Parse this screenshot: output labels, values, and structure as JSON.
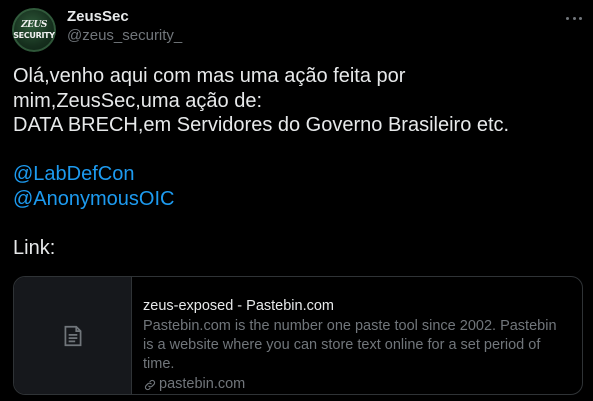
{
  "author": {
    "display_name": "ZeusSec",
    "handle": "@zeus_security_",
    "avatar_logo": [
      "ZEUS",
      "SECURITY"
    ]
  },
  "tweet": {
    "lines": [
      "Olá,venho aqui com mas uma ação feita por",
      "mim,ZeusSec,uma ação de:",
      "DATA BRECH,em Servidores do Governo Brasileiro etc."
    ],
    "mentions": [
      "@LabDefCon",
      "@AnonymousOIC"
    ],
    "link_label": "Link:"
  },
  "card": {
    "title": "zeus-exposed - Pastebin.com",
    "description": "Pastebin.com is the number one paste tool since 2002. Pastebin is a website where you can store text online for a set period of time.",
    "domain": "pastebin.com",
    "thumb_icon": "document-icon",
    "domain_icon": "link-icon"
  },
  "icons": {
    "more": "more-options-icon"
  },
  "colors": {
    "background": "#000000",
    "text": "#e7e9ea",
    "muted": "#71767b",
    "accent": "#1d9bf0",
    "border": "#2f3336"
  }
}
